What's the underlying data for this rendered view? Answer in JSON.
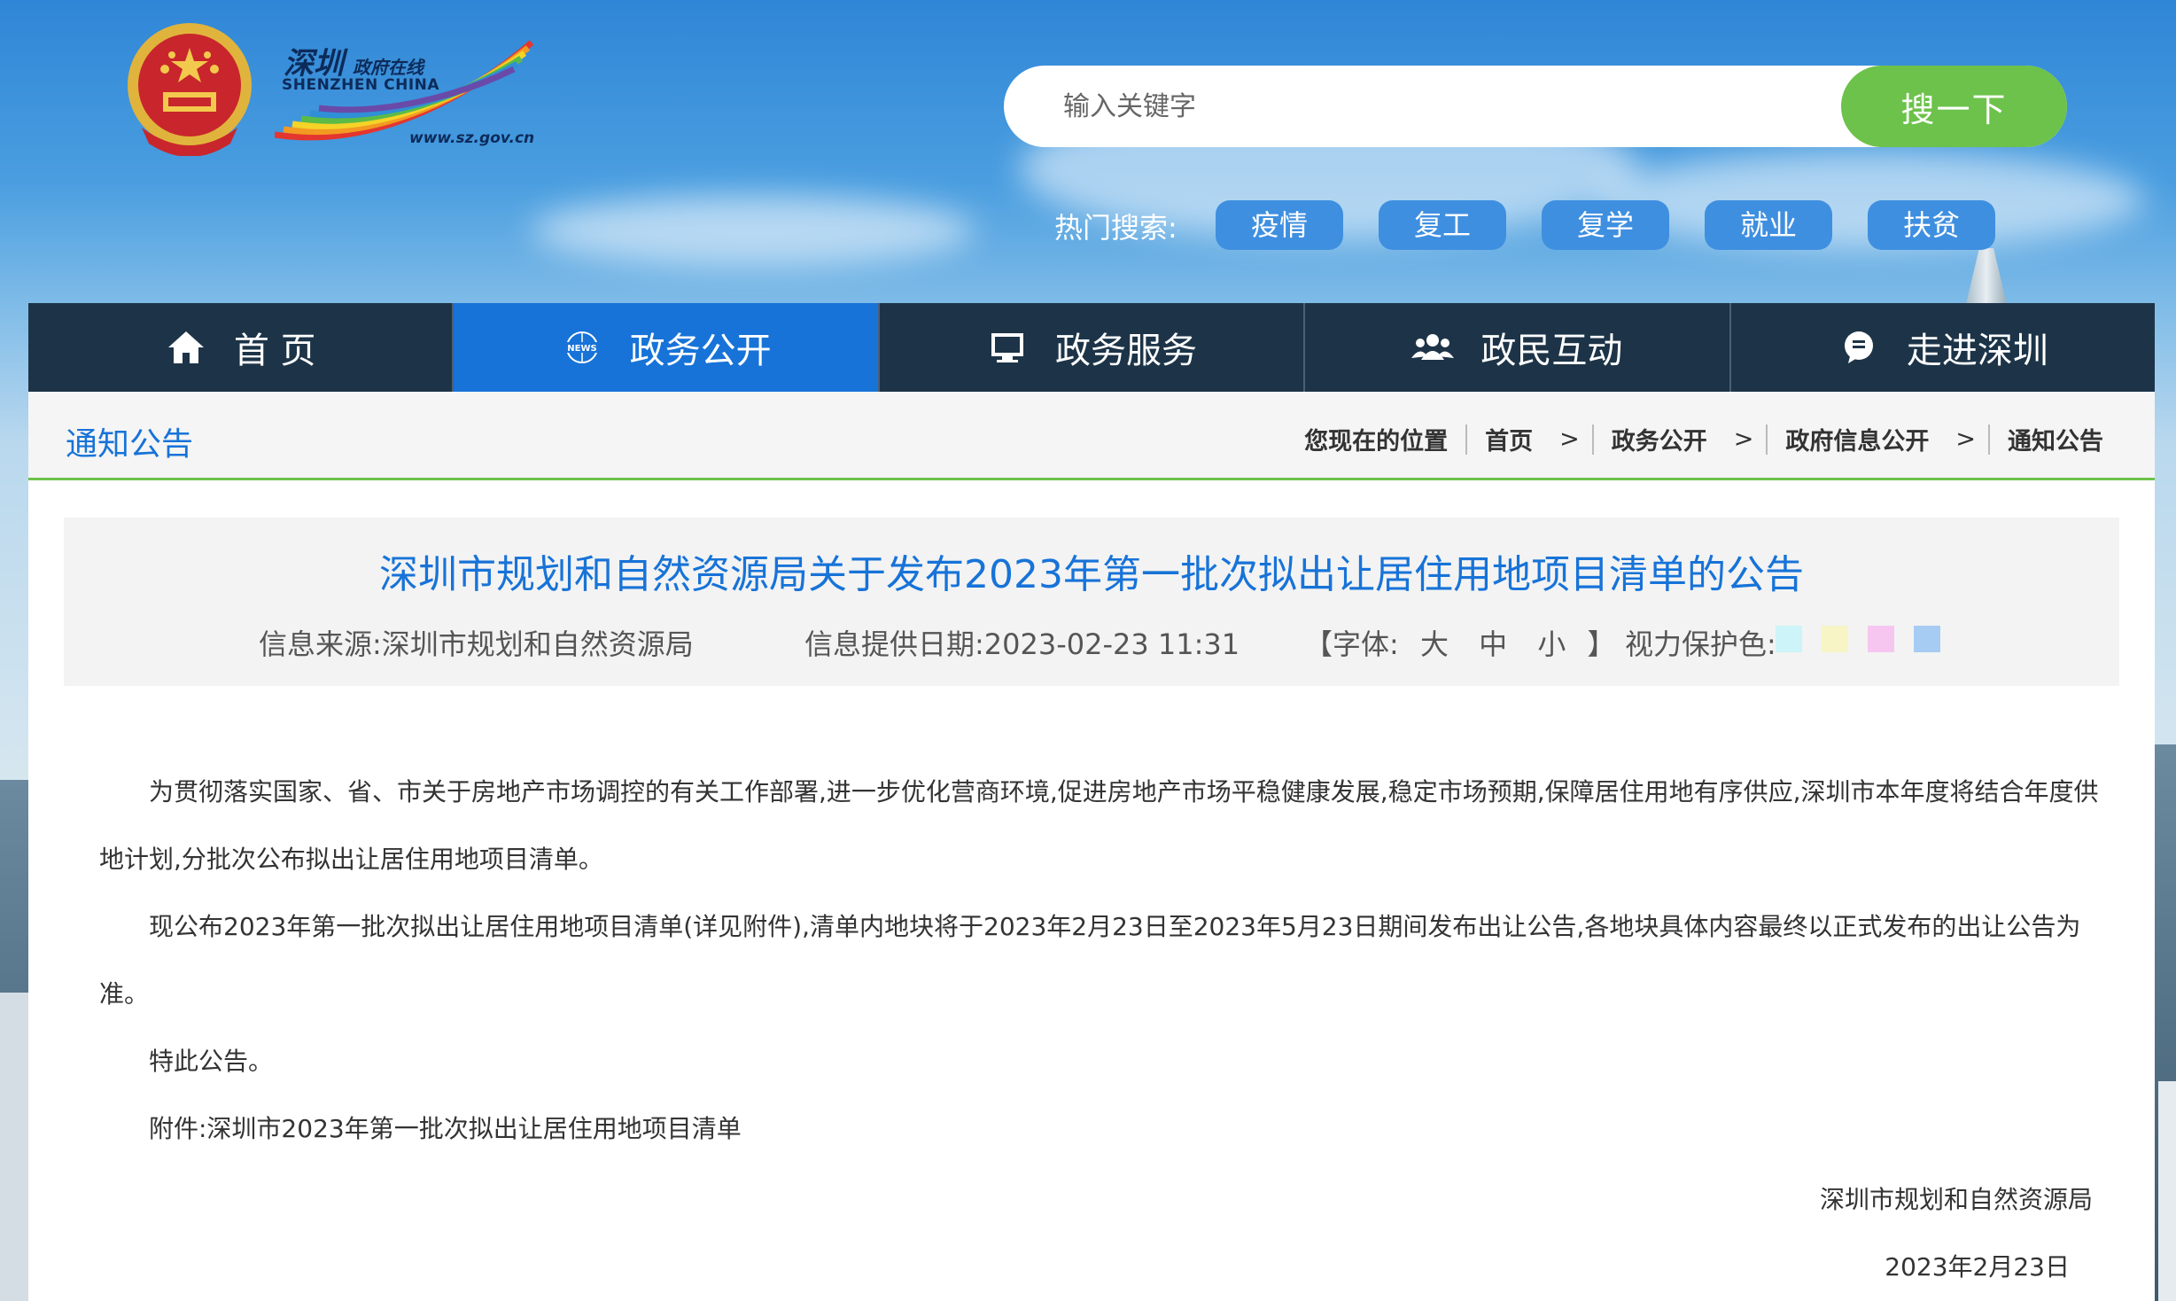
{
  "header": {
    "logo": {
      "cn": "深圳",
      "cn_small": "政府在线",
      "en": "SHENZHEN CHINA",
      "url": "www.sz.gov.cn"
    },
    "search": {
      "placeholder": "输入关键字",
      "button_label": "搜一下"
    },
    "hot_search": {
      "label": "热门搜索:",
      "tags": [
        "疫情",
        "复工",
        "复学",
        "就业",
        "扶贫"
      ]
    }
  },
  "nav": {
    "items": [
      {
        "label": "首 页",
        "icon": "home-icon"
      },
      {
        "label": "政务公开",
        "icon": "news-icon"
      },
      {
        "label": "政务服务",
        "icon": "monitor-icon"
      },
      {
        "label": "政民互动",
        "icon": "people-icon"
      },
      {
        "label": "走进深圳",
        "icon": "chat-icon"
      }
    ],
    "active_index": 1
  },
  "section": {
    "title": "通知公告",
    "breadcrumb": {
      "label": "您现在的位置",
      "items": [
        "首页",
        "政务公开",
        "政府信息公开",
        "通知公告"
      ]
    }
  },
  "article": {
    "title": "深圳市规划和自然资源局关于发布2023年第一批次拟出让居住用地项目清单的公告",
    "source": "信息来源:深圳市规划和自然资源局",
    "date": "信息提供日期:2023-02-23 11:31",
    "font_size": {
      "open": "【字体:",
      "large": "大",
      "medium": "中",
      "small": "小",
      "close": "】"
    },
    "eye_care_label": "视力保护色:",
    "eye_care_colors": [
      "#cdf4f8",
      "#f7f5c6",
      "#f7c6f0",
      "#a6ccf3"
    ],
    "paragraphs": [
      "为贯彻落实国家、省、市关于房地产市场调控的有关工作部署,进一步优化营商环境,促进房地产市场平稳健康发展,稳定市场预期,保障居住用地有序供应,深圳市本年度将结合年度供地计划,分批次公布拟出让居住用地项目清单。",
      "现公布2023年第一批次拟出让居住用地项目清单(详见附件),清单内地块将于2023年2月23日至2023年5月23日期间发布出让公告,各地块具体内容最终以正式发布的出让公告为准。",
      "特此公告。",
      "附件:深圳市2023年第一批次拟出让居住用地项目清单"
    ],
    "signature": "深圳市规划和自然资源局",
    "signature_date": "2023年2月23日"
  },
  "colors": {
    "nav_bg": "#1d3448",
    "nav_active": "#1773d8",
    "accent_green": "#6cc24a",
    "title_blue": "#1773d8"
  }
}
